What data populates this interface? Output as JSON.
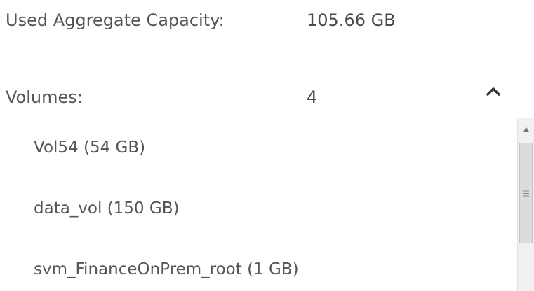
{
  "summary": {
    "used_capacity_label": "Used Aggregate Capacity:",
    "used_capacity_value": "105.66 GB"
  },
  "volumes": {
    "label": "Volumes:",
    "count": "4",
    "expanded": true,
    "collapse_icon": "chevron-up-icon",
    "items": [
      {
        "label": "Vol54 (54 GB)"
      },
      {
        "label": "data_vol (150 GB)"
      },
      {
        "label": "svm_FinanceOnPrem_root (1 GB)"
      }
    ]
  },
  "scrollbar": {
    "up_icon": "arrow-up-icon",
    "grip_icon": "grip-lines-icon"
  },
  "colors": {
    "text": "#555555",
    "divider": "#d6d6d6",
    "scroll_track": "#f1f1f1",
    "scroll_thumb": "#dcdcdc"
  }
}
